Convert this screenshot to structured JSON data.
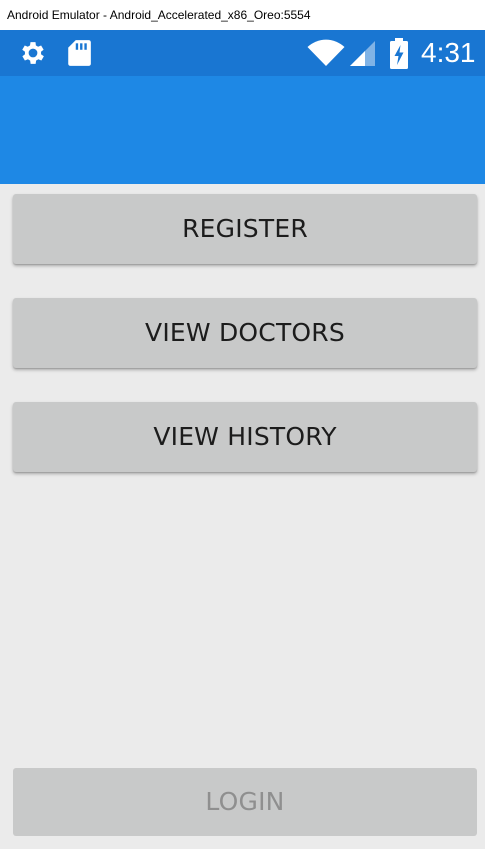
{
  "window": {
    "title": "Android Emulator - Android_Accelerated_x86_Oreo:5554"
  },
  "status_bar": {
    "time": "4:31",
    "icons": [
      "gear-icon",
      "sd-card-icon",
      "wifi-icon",
      "cell-signal-icon",
      "battery-charging-icon"
    ],
    "background_color": "#1976d2"
  },
  "app_bar": {
    "background_color": "#1e88e5"
  },
  "buttons": {
    "register": "REGISTER",
    "view_doctors": "VIEW DOCTORS",
    "view_history": "VIEW HISTORY",
    "login": "LOGIN"
  },
  "colors": {
    "content_background": "#ebebeb",
    "button_background": "#c8c9c9",
    "disabled_text": "#8f8f8f"
  }
}
